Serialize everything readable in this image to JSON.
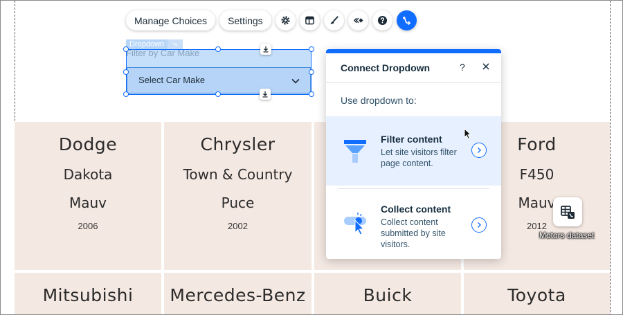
{
  "toolbar": {
    "manage_choices": "Manage Choices",
    "settings": "Settings",
    "icons": [
      "gear-icon",
      "layout-icon",
      "brush-icon",
      "animation-icon",
      "help-icon",
      "connect-data-icon"
    ]
  },
  "dropdown": {
    "tag": "Dropdown",
    "label": "Filter by Car Make",
    "placeholder": "Select Car Make"
  },
  "panel": {
    "title": "Connect Dropdown",
    "help": "?",
    "subtitle": "Use dropdown to:",
    "options": [
      {
        "title": "Filter content",
        "description": "Let site visitors filter page content.",
        "icon": "funnel-icon"
      },
      {
        "title": "Collect content",
        "description": "Collect content submitted by site visitors.",
        "icon": "toggle-cursor-icon"
      }
    ]
  },
  "cars": [
    {
      "make": "Dodge",
      "model": "Dakota",
      "color": "Mauv",
      "year": "2006"
    },
    {
      "make": "Chrysler",
      "model": "Town & Country",
      "color": "Puce",
      "year": "2002"
    },
    {
      "make": "",
      "model": "",
      "color": "",
      "year": ""
    },
    {
      "make": "Ford",
      "model": "F450",
      "color": "Mauv",
      "year": "2012"
    },
    {
      "make": "Mitsubishi"
    },
    {
      "make": "Mercedes-Benz"
    },
    {
      "make": "Buick"
    },
    {
      "make": "Toyota"
    }
  ],
  "dataset": {
    "label": "Motors dataset"
  },
  "colors": {
    "accent": "#116dff",
    "card": "#f4e8e2",
    "highlight": "#e7f0ff"
  }
}
